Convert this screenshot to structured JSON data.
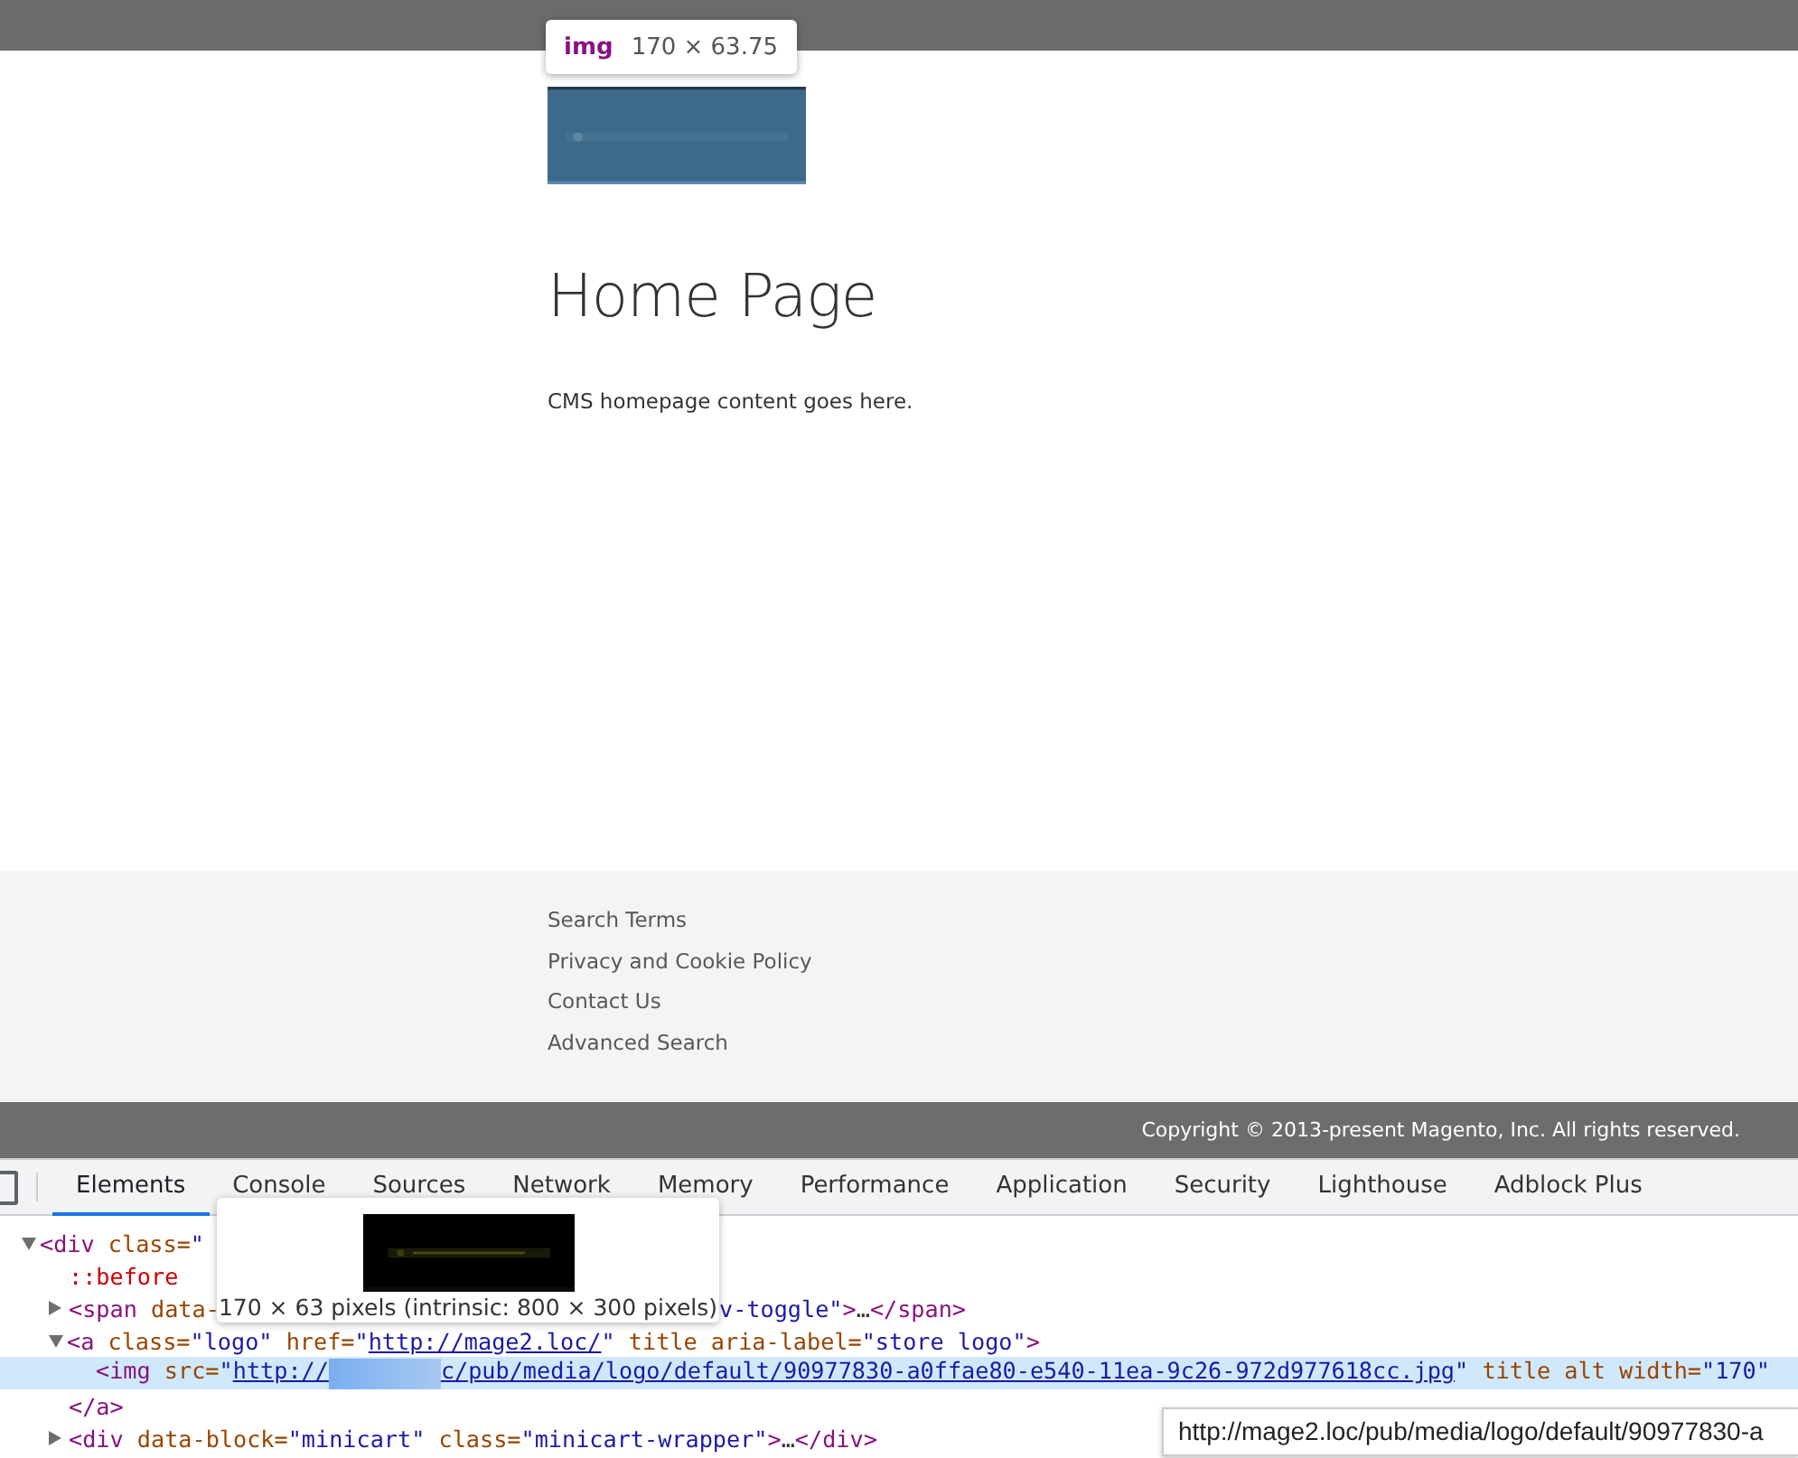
{
  "inspect_tooltip": {
    "tag": "img",
    "size": "170 × 63.75"
  },
  "page": {
    "title": "Home Page",
    "content": "CMS homepage content goes here."
  },
  "footer": {
    "links": [
      "Search Terms",
      "Privacy and Cookie Policy",
      "Contact Us",
      "Advanced Search"
    ],
    "copyright": "Copyright © 2013-present Magento, Inc. All rights reserved."
  },
  "devtools": {
    "tabs": [
      {
        "label": "Elements",
        "selected": true
      },
      {
        "label": "Console",
        "selected": false
      },
      {
        "label": "Sources",
        "selected": false
      },
      {
        "label": "Network",
        "selected": false
      },
      {
        "label": "Memory",
        "selected": false
      },
      {
        "label": "Performance",
        "selected": false
      },
      {
        "label": "Application",
        "selected": false
      },
      {
        "label": "Security",
        "selected": false
      },
      {
        "label": "Lighthouse",
        "selected": false
      },
      {
        "label": "Adblock Plus",
        "selected": false
      }
    ],
    "tree": [
      {
        "expanded": true,
        "selected": false,
        "tokens": [
          {
            "kind": "tag",
            "text": "<div"
          },
          {
            "kind": "attr",
            "text": " class="
          },
          {
            "kind": "value",
            "text": "\""
          }
        ],
        "children": [
          {
            "selected": false,
            "tokens": [
              {
                "kind": "pseudo",
                "text": "::before"
              }
            ]
          },
          {
            "expanded": false,
            "selected": false,
            "tokens": [
              {
                "kind": "tag",
                "text": "<span"
              },
              {
                "kind": "attr",
                "text": " data-"
              }
            ],
            "tokens_after": [
              {
                "kind": "value",
                "text": "v-toggle\""
              },
              {
                "kind": "tag",
                "text": ">"
              },
              {
                "kind": "plain",
                "text": "…"
              },
              {
                "kind": "tag",
                "text": "</span>"
              }
            ]
          },
          {
            "expanded": true,
            "selected": false,
            "tokens": [
              {
                "kind": "tag",
                "text": "<a"
              },
              {
                "kind": "attr",
                "text": " class="
              },
              {
                "kind": "value",
                "text": "\"logo\""
              },
              {
                "kind": "attr",
                "text": " href="
              },
              {
                "kind": "value",
                "text": "\""
              },
              {
                "kind": "link",
                "text": "http://mage2.loc/"
              },
              {
                "kind": "value",
                "text": "\""
              },
              {
                "kind": "attr",
                "text": " title aria-label="
              },
              {
                "kind": "value",
                "text": "\"store logo\""
              },
              {
                "kind": "tag",
                "text": ">"
              }
            ],
            "close": "</a>",
            "children": [
              {
                "selected": true,
                "tokens": [
                  {
                    "kind": "tag",
                    "text": "<img"
                  },
                  {
                    "kind": "attr",
                    "text": " src="
                  },
                  {
                    "kind": "value",
                    "text": "\""
                  },
                  {
                    "kind": "link",
                    "text": "http://"
                  },
                  {
                    "kind": "redacted"
                  },
                  {
                    "kind": "link",
                    "text": "c/pub/media/logo/default/90977830-a0ffae80-e540-11ea-9c26-972d977618cc.jpg"
                  },
                  {
                    "kind": "value",
                    "text": "\""
                  },
                  {
                    "kind": "attr",
                    "text": " title alt width="
                  },
                  {
                    "kind": "value",
                    "text": "\"170\""
                  }
                ]
              }
            ]
          },
          {
            "expanded": false,
            "selected": false,
            "tokens": [
              {
                "kind": "tag",
                "text": "<div"
              },
              {
                "kind": "attr",
                "text": " data-block="
              },
              {
                "kind": "value",
                "text": "\"minicart\""
              },
              {
                "kind": "attr",
                "text": " class="
              },
              {
                "kind": "value",
                "text": "\"minicart-wrapper\""
              },
              {
                "kind": "tag",
                "text": ">"
              },
              {
                "kind": "plain",
                "text": "…"
              },
              {
                "kind": "tag",
                "text": "</div>"
              }
            ]
          }
        ]
      }
    ],
    "image_tooltip": {
      "caption": "170 × 63 pixels (intrinsic: 800 × 300 pixels)"
    },
    "url_tooltip": "http://mage2.loc/pub/media/logo/default/90977830-a"
  }
}
